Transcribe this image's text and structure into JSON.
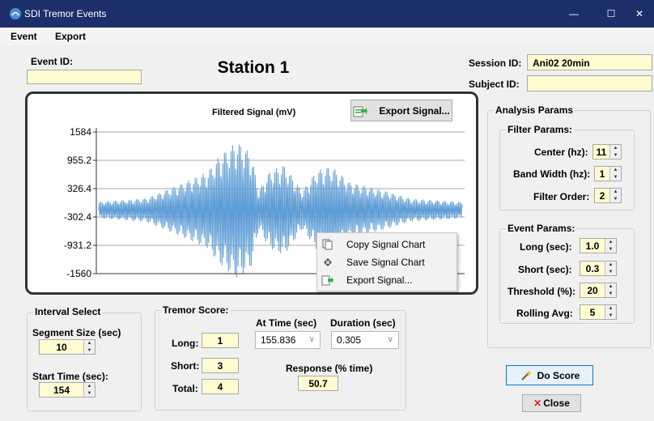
{
  "window": {
    "title": "SDI Tremor Events",
    "minimize": "—",
    "maximize": "☐",
    "close": "✕"
  },
  "menu": [
    "Event",
    "Export"
  ],
  "event_id": {
    "label": "Event ID:",
    "value": ""
  },
  "station_title": "Station 1",
  "session_id": {
    "label": "Session ID:",
    "value": "Ani02 20min"
  },
  "subject_id": {
    "label": "Subject ID:",
    "value": ""
  },
  "chart": {
    "title": "Filtered Signal (mV)",
    "export_button": "Export Signal...",
    "y_ticks": [
      "1584",
      "955.2",
      "326.4",
      "-302.4",
      "-931.2",
      "-1560"
    ]
  },
  "chart_data": {
    "type": "line",
    "title": "Filtered Signal (mV)",
    "ylim": [
      -1560,
      1584
    ],
    "y_ticks": [
      1584,
      955.2,
      326.4,
      -302.4,
      -931.2,
      -1560
    ],
    "grid": true,
    "series_color": "#5b9bd5",
    "envelope": [
      {
        "t": 0.0,
        "amp": 180
      },
      {
        "t": 0.13,
        "amp": 260
      },
      {
        "t": 0.22,
        "amp": 560
      },
      {
        "t": 0.3,
        "amp": 850
      },
      {
        "t": 0.33,
        "amp": 1180
      },
      {
        "t": 0.38,
        "amp": 1520
      },
      {
        "t": 0.42,
        "amp": 1250
      },
      {
        "t": 0.44,
        "amp": 420
      },
      {
        "t": 0.47,
        "amp": 850
      },
      {
        "t": 0.51,
        "amp": 1000
      },
      {
        "t": 0.56,
        "amp": 420
      },
      {
        "t": 0.6,
        "amp": 880
      },
      {
        "t": 0.64,
        "amp": 980
      },
      {
        "t": 0.69,
        "amp": 620
      },
      {
        "t": 0.79,
        "amp": 420
      },
      {
        "t": 0.86,
        "amp": 250
      },
      {
        "t": 1.0,
        "amp": 180
      }
    ]
  },
  "context_menu": {
    "items": [
      {
        "label": "Copy Signal Chart",
        "icon": "copy-icon"
      },
      {
        "label": "Save Signal Chart",
        "icon": "save-icon"
      },
      {
        "label": "Export Signal...",
        "icon": "export-icon"
      }
    ]
  },
  "analysis_params": {
    "title": "Analysis Params",
    "filter": {
      "title": "Filter Params:",
      "center": {
        "label": "Center (hz):",
        "value": "11"
      },
      "bandwidth": {
        "label": "Band Width (hz):",
        "value": "1"
      },
      "order": {
        "label": "Filter Order:",
        "value": "2"
      }
    },
    "event": {
      "title": "Event Params:",
      "long": {
        "label": "Long (sec):",
        "value": "1.0"
      },
      "short": {
        "label": "Short (sec):",
        "value": "0.3"
      },
      "threshold": {
        "label": "Threshold (%):",
        "value": "20"
      },
      "rolling": {
        "label": "Rolling Avg:",
        "value": "5"
      }
    }
  },
  "interval_select": {
    "title": "Interval Select",
    "segment": {
      "label": "Segment Size (sec)",
      "value": "10"
    },
    "start": {
      "label": "Start Time (sec):",
      "value": "154"
    }
  },
  "tremor_score": {
    "title": "Tremor Score:",
    "long": {
      "label": "Long:",
      "value": "1"
    },
    "short": {
      "label": "Short:",
      "value": "3"
    },
    "total": {
      "label": "Total:",
      "value": "4"
    },
    "at_time": {
      "label": "At Time (sec)",
      "value": "155.836"
    },
    "duration": {
      "label": "Duration (sec)",
      "value": "0.305"
    },
    "response": {
      "label": "Response (% time)",
      "value": "50.7"
    }
  },
  "buttons": {
    "do_score": "Do Score",
    "close": "Close"
  },
  "colors": {
    "titlebar": "#1c2f6b",
    "field": "#fffbd1",
    "signal": "#5b9bd5",
    "accent_button": "#0078d7"
  }
}
